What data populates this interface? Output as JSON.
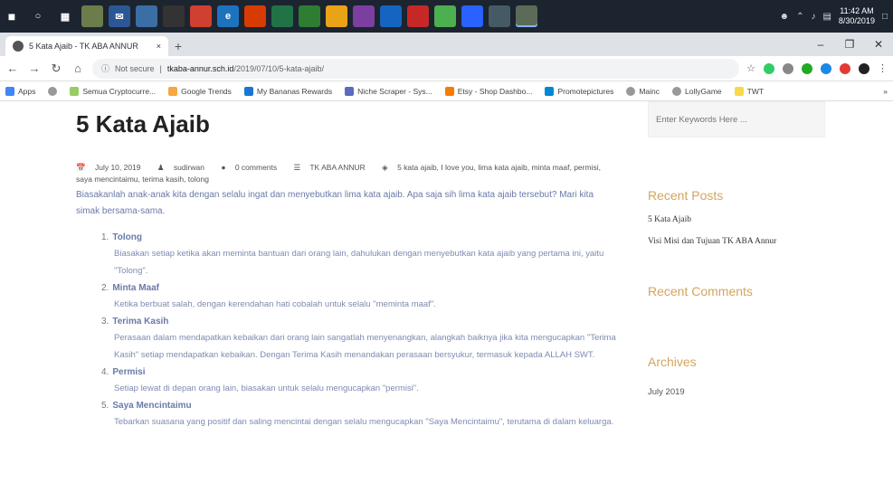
{
  "taskbar": {
    "clock_time": "11:42 AM",
    "clock_date": "8/30/2019"
  },
  "browser": {
    "tab_title": "5 Kata Ajaib - TK ABA ANNUR",
    "tab_close": "×",
    "new_tab": "+",
    "address_security": "Not secure",
    "address_host": "tkaba-annur.sch.id",
    "address_path": "/2019/07/10/5-kata-ajaib/",
    "bookmarks": [
      "Apps",
      "Semua Cryptocurre...",
      "Google Trends",
      "My Bananas Rewards",
      "Niche Scraper - Sys...",
      "Etsy - Shop Dashbo...",
      "Promotepictures",
      "Mainc",
      "LollyGame",
      "TWT"
    ],
    "bookmarks_more": "»"
  },
  "post": {
    "title": "5 Kata Ajaib",
    "meta": {
      "date": "July 10, 2019",
      "author": "sudirwan",
      "comments": "0 comments",
      "category": "TK ABA ANNUR",
      "tags": "5 kata ajaib, I love you, lima kata ajaib, minta maaf, permisi, saya mencintaimu, terima kasih, tolong"
    },
    "intro": "Biasakanlah anak-anak kita dengan selalu ingat dan menyebutkan lima kata ajaib. Apa saja sih lima kata ajaib tersebut? Mari kita simak bersama-sama.",
    "points": [
      {
        "num": "1.",
        "title": "Tolong",
        "body": "Biasakan setiap ketika akan meminta bantuan dari orang lain, dahulukan dengan menyebutkan kata ajaib yang pertama ini, yaitu \"Tolong\"."
      },
      {
        "num": "2.",
        "title": "Minta Maaf",
        "body": "Ketika berbuat salah, dengan kerendahan hati cobalah untuk selalu \"meminta maaf\"."
      },
      {
        "num": "3.",
        "title": "Terima Kasih",
        "body": "Perasaan dalam mendapatkan kebaikan dari orang lain sangatlah menyenangkan, alangkah baiknya jika kita mengucapkan \"Terima Kasih\" setiap mendapatkan kebaikan. Dengan Terima Kasih menandakan perasaan bersyukur, termasuk kepada ALLAH SWT."
      },
      {
        "num": "4.",
        "title": "Permisi",
        "body": "Setiap lewat di depan orang lain, biasakan untuk selalu mengucapkan \"permisi\"."
      },
      {
        "num": "5.",
        "title": "Saya Mencintaimu",
        "body": "Tebarkan suasana yang positif dan saling mencintai dengan selalu mengucapkan \"Saya Mencintaimu\", terutama di dalam keluarga."
      }
    ]
  },
  "sidebar": {
    "search_placeholder": "Enter Keywords Here ...",
    "recent_posts_title": "Recent Posts",
    "recent_posts": [
      "5 Kata Ajaib",
      "Visi Misi dan Tujuan TK ABA Annur"
    ],
    "recent_comments_title": "Recent Comments",
    "archives_title": "Archives",
    "archives": [
      "July 2019"
    ]
  },
  "colors": {
    "accent": "#d4a55a",
    "body_text": "#6a7aa8",
    "taskbar": "#1c2430"
  }
}
